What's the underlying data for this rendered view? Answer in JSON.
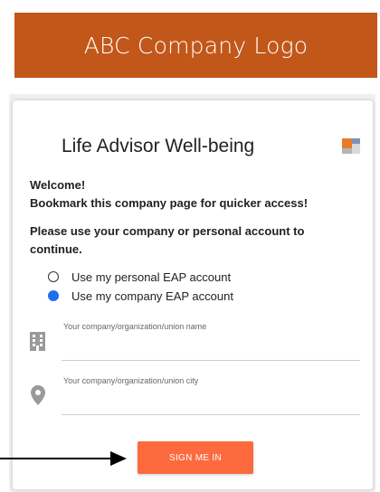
{
  "header": {
    "logo_text": "ABC Company Logo"
  },
  "card": {
    "title": "Life Advisor Well-being",
    "welcome": "Welcome!",
    "bookmark": "Bookmark this company page for quicker access!",
    "instruction": "Please use your company or personal account to continue.",
    "options": [
      {
        "label": "Use my personal EAP account",
        "selected": false
      },
      {
        "label": "Use my company EAP account",
        "selected": true
      }
    ],
    "fields": {
      "company_name_placeholder": "Your company/organization/union name",
      "company_city_placeholder": "Your company/organization/union city"
    },
    "signin_label": "SIGN ME IN"
  },
  "colors": {
    "brand": "#c2571a",
    "button": "#fd6a3e",
    "radio_selected": "#1e6fe8"
  },
  "icons": [
    "building-icon",
    "location-pin-icon",
    "app-logo-icon",
    "arrow-icon"
  ]
}
